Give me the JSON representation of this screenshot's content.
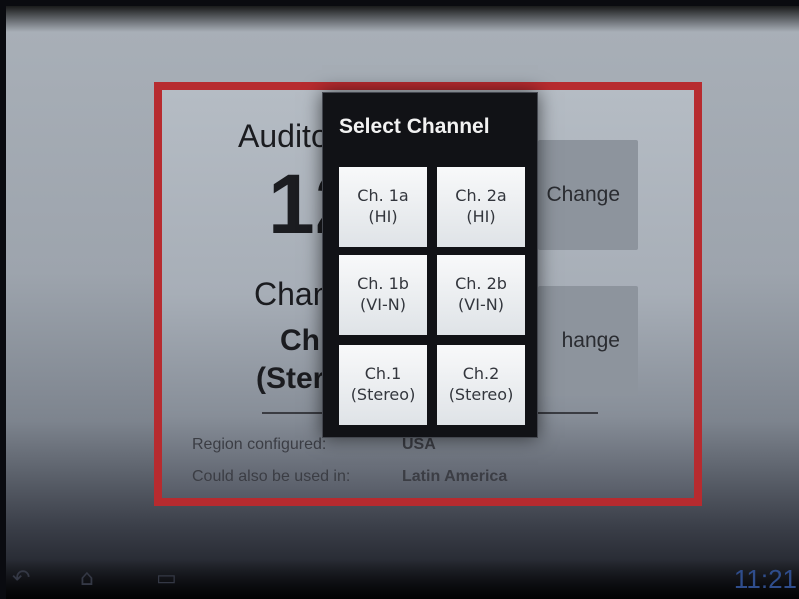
{
  "app": {
    "auditorium_label": "Audito",
    "auditorium_number": "12",
    "channel_label": "Chan",
    "channel_value": "Ch.",
    "channel_sub": "(Ster",
    "change_label_1": "Change",
    "change_label_2": "hange",
    "info": [
      {
        "label": "Region configured:",
        "value": "USA"
      },
      {
        "label": "Could also be used in:",
        "value": "Latin America"
      }
    ]
  },
  "dialog": {
    "title": "Select Channel",
    "channels": [
      {
        "line1": "Ch. 1a",
        "line2": "(HI)"
      },
      {
        "line1": "Ch. 2a",
        "line2": "(HI)"
      },
      {
        "line1": "Ch. 1b",
        "line2": "(VI-N)"
      },
      {
        "line1": "Ch. 2b",
        "line2": "(VI-N)"
      },
      {
        "line1": "Ch.1",
        "line2": "(Stereo)"
      },
      {
        "line1": "Ch.2",
        "line2": "(Stereo)"
      }
    ]
  },
  "status_bar": {
    "time": "11:21",
    "nav_icons": [
      "back-icon",
      "home-icon",
      "recent-apps-icon"
    ]
  },
  "colors": {
    "accent": "#b72b2f",
    "dialog_bg": "#111216",
    "button_bg": "#eceff2",
    "clock": "#2f4d8c"
  }
}
